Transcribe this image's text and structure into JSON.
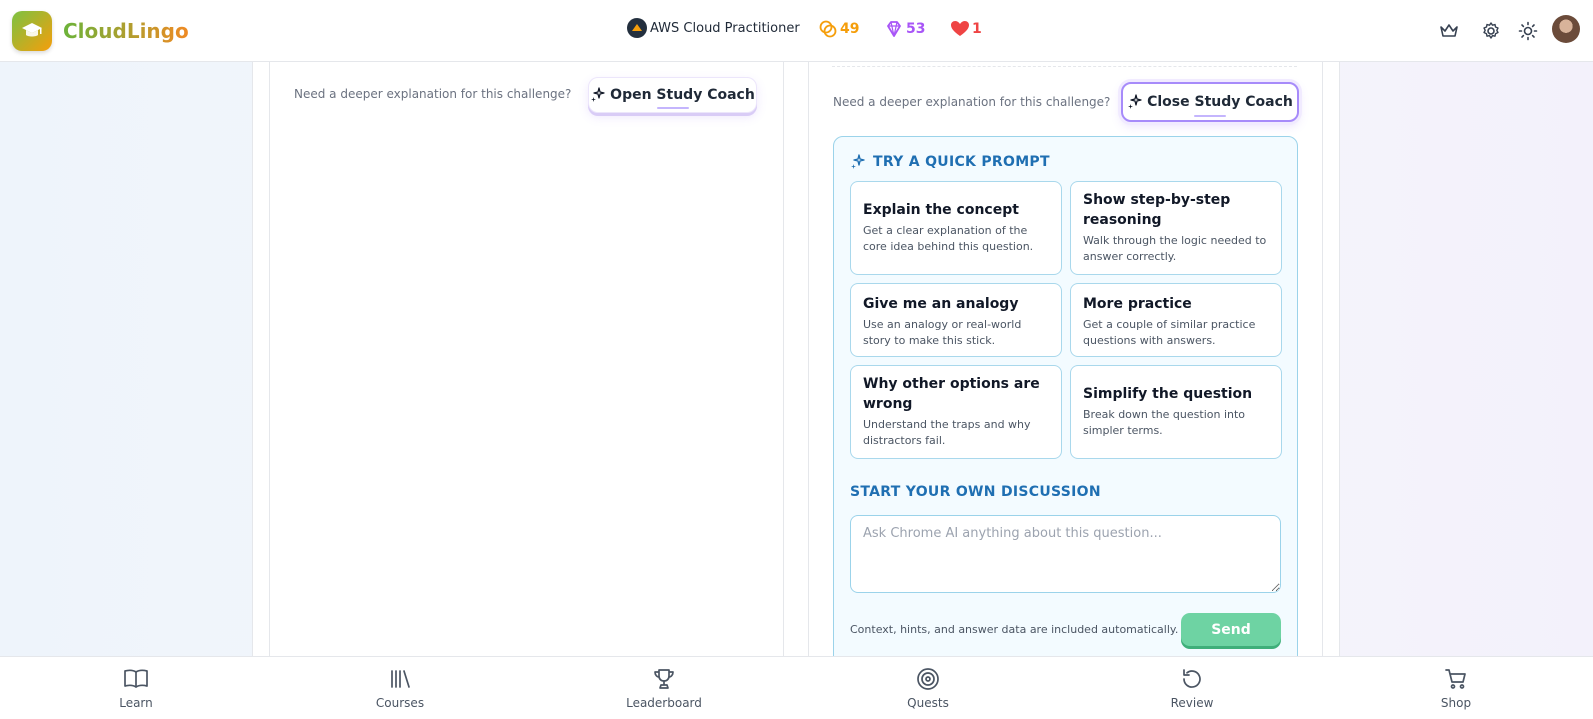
{
  "app": {
    "name": "CloudLingo"
  },
  "header": {
    "course": "AWS Cloud Practitioner",
    "xp": "49",
    "gems": "53",
    "hearts": "1",
    "icons": [
      "crown-icon",
      "gear-icon",
      "sun-icon",
      "avatar"
    ]
  },
  "left_card": {
    "helper": "Need a deeper explanation for this challenge?",
    "button": "Open Study Coach"
  },
  "right_card": {
    "helper": "Need a deeper explanation for this challenge?",
    "button": "Close Study Coach"
  },
  "quick_prompts": {
    "title": "TRY A QUICK PROMPT",
    "items": [
      {
        "title": "Explain the concept",
        "desc": "Get a clear explanation of the core idea behind this question."
      },
      {
        "title": "Show step-by-step reasoning",
        "desc": "Walk through the logic needed to answer correctly."
      },
      {
        "title": "Give me an analogy",
        "desc": "Use an analogy or real-world story to make this stick."
      },
      {
        "title": "More practice",
        "desc": "Get a couple of similar practice questions with answers."
      },
      {
        "title": "Why other options are wrong",
        "desc": "Understand the traps and why distractors fail."
      },
      {
        "title": "Simplify the question",
        "desc": "Break down the question into simpler terms."
      }
    ]
  },
  "discussion": {
    "title": "START YOUR OWN DISCUSSION",
    "placeholder": "Ask Chrome AI anything about this question...",
    "note": "Context, hints, and answer data are included automatically.",
    "send": "Send"
  },
  "bottom_nav": [
    "Learn",
    "Courses",
    "Leaderboard",
    "Quests",
    "Review",
    "Shop"
  ],
  "colors": {
    "accent_purple": "#a78bfa",
    "accent_blue": "#1f6fb2",
    "send_green": "#6ed3a3"
  }
}
